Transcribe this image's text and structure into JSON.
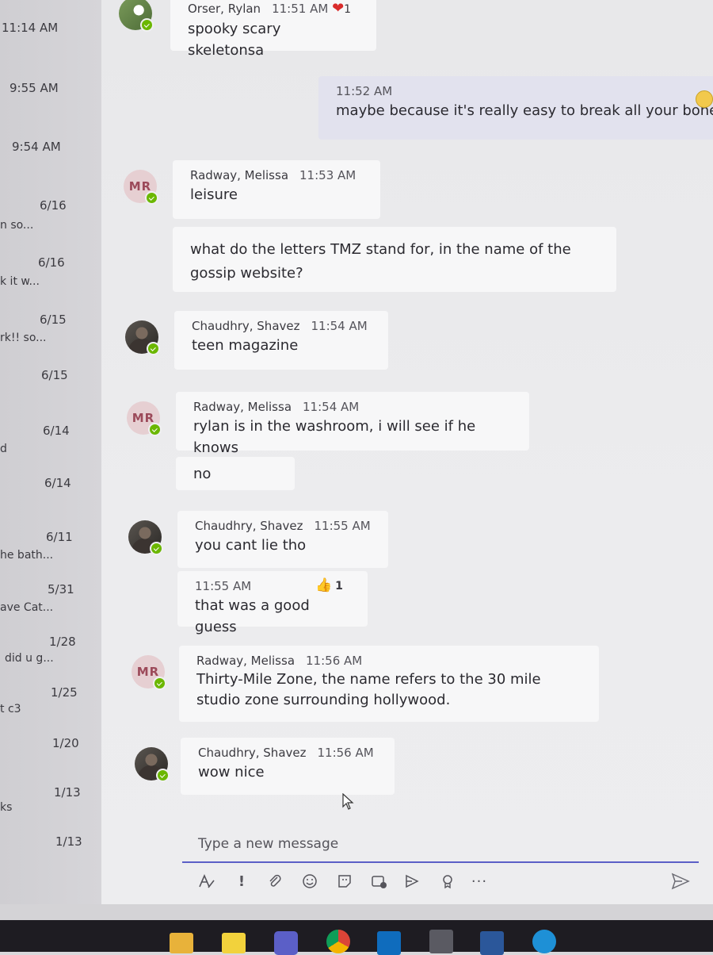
{
  "chat_list": [
    {
      "time": "11:14 AM",
      "preview": ""
    },
    {
      "time": "9:55 AM",
      "preview": ""
    },
    {
      "time": "9:54 AM",
      "preview": ""
    },
    {
      "time": "6/16",
      "preview": "n so..."
    },
    {
      "time": "6/16",
      "preview": "k it w..."
    },
    {
      "time": "6/15",
      "preview": "rk!! so..."
    },
    {
      "time": "6/15",
      "preview": ""
    },
    {
      "time": "6/14",
      "preview": "d"
    },
    {
      "time": "6/14",
      "preview": ""
    },
    {
      "time": "6/11",
      "preview": "he bath..."
    },
    {
      "time": "5/31",
      "preview": "ave Cat..."
    },
    {
      "time": "1/28",
      "preview": "did u g..."
    },
    {
      "time": "1/25",
      "preview": "t c3"
    },
    {
      "time": "1/20",
      "preview": ""
    },
    {
      "time": "1/13",
      "preview": "ks"
    },
    {
      "time": "1/13",
      "preview": ""
    }
  ],
  "messages": [
    {
      "sender": "Orser, Rylan",
      "time": "11:51 AM",
      "text": "spooky scary skeletonsa",
      "reaction_count": "1",
      "reaction": "heart",
      "initials": ""
    },
    {
      "sender": "",
      "time": "11:52 AM",
      "text": "maybe because it's really easy to break all your bone",
      "mine": true
    },
    {
      "sender": "Radway, Melissa",
      "time": "11:53 AM",
      "text": "leisure",
      "initials": "MR"
    },
    {
      "sender": "",
      "time": "",
      "text": "what do the letters TMZ stand for, in the name of the gossip website?"
    },
    {
      "sender": "Chaudhry, Shavez",
      "time": "11:54 AM",
      "text": "teen magazine"
    },
    {
      "sender": "Radway, Melissa",
      "time": "11:54 AM",
      "text": "rylan is in the washroom, i will see if he knows",
      "initials": "MR"
    },
    {
      "sender": "",
      "time": "",
      "text": "no"
    },
    {
      "sender": "Chaudhry, Shavez",
      "time": "11:55 AM",
      "text": "you cant lie tho"
    },
    {
      "sender": "",
      "time": "11:55 AM",
      "text": "that was a good guess",
      "reaction": "thumbs-up",
      "reaction_count": "1"
    },
    {
      "sender": "Radway, Melissa",
      "time": "11:56 AM",
      "text": "Thirty-Mile Zone, the name refers to the 30 mile studio zone surrounding hollywood.",
      "initials": "MR"
    },
    {
      "sender": "Chaudhry, Shavez",
      "time": "11:56 AM",
      "text": "wow nice"
    }
  ],
  "compose": {
    "placeholder": "Type a new message"
  },
  "toolbar_icons": [
    "format-icon",
    "important-icon",
    "attach-icon",
    "emoji-icon",
    "sticker-icon",
    "meet-icon",
    "stream-icon",
    "praise-icon",
    "more-icon"
  ],
  "colors": {
    "accent": "#5b5fc7",
    "presence": "#6bb700",
    "avatar_initials_bg": "#e6cfd2"
  }
}
